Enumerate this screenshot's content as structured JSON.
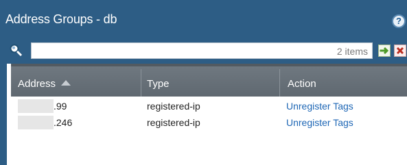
{
  "dialog": {
    "title": "Address Groups - db",
    "help_icon": "?"
  },
  "toolbar": {
    "search_placeholder": "",
    "items_count": "2 items",
    "go_icon": "arrow-right-icon",
    "clear_icon": "clear-x-icon"
  },
  "table": {
    "headers": [
      "Address",
      "Type",
      "Action"
    ],
    "sort_icon": "sort-ascending-icon",
    "rows": [
      {
        "address_suffix": ".99",
        "type": "registered-ip",
        "action": "Unregister Tags"
      },
      {
        "address_suffix": ".246",
        "type": "registered-ip",
        "action": "Unregister Tags"
      }
    ]
  }
}
